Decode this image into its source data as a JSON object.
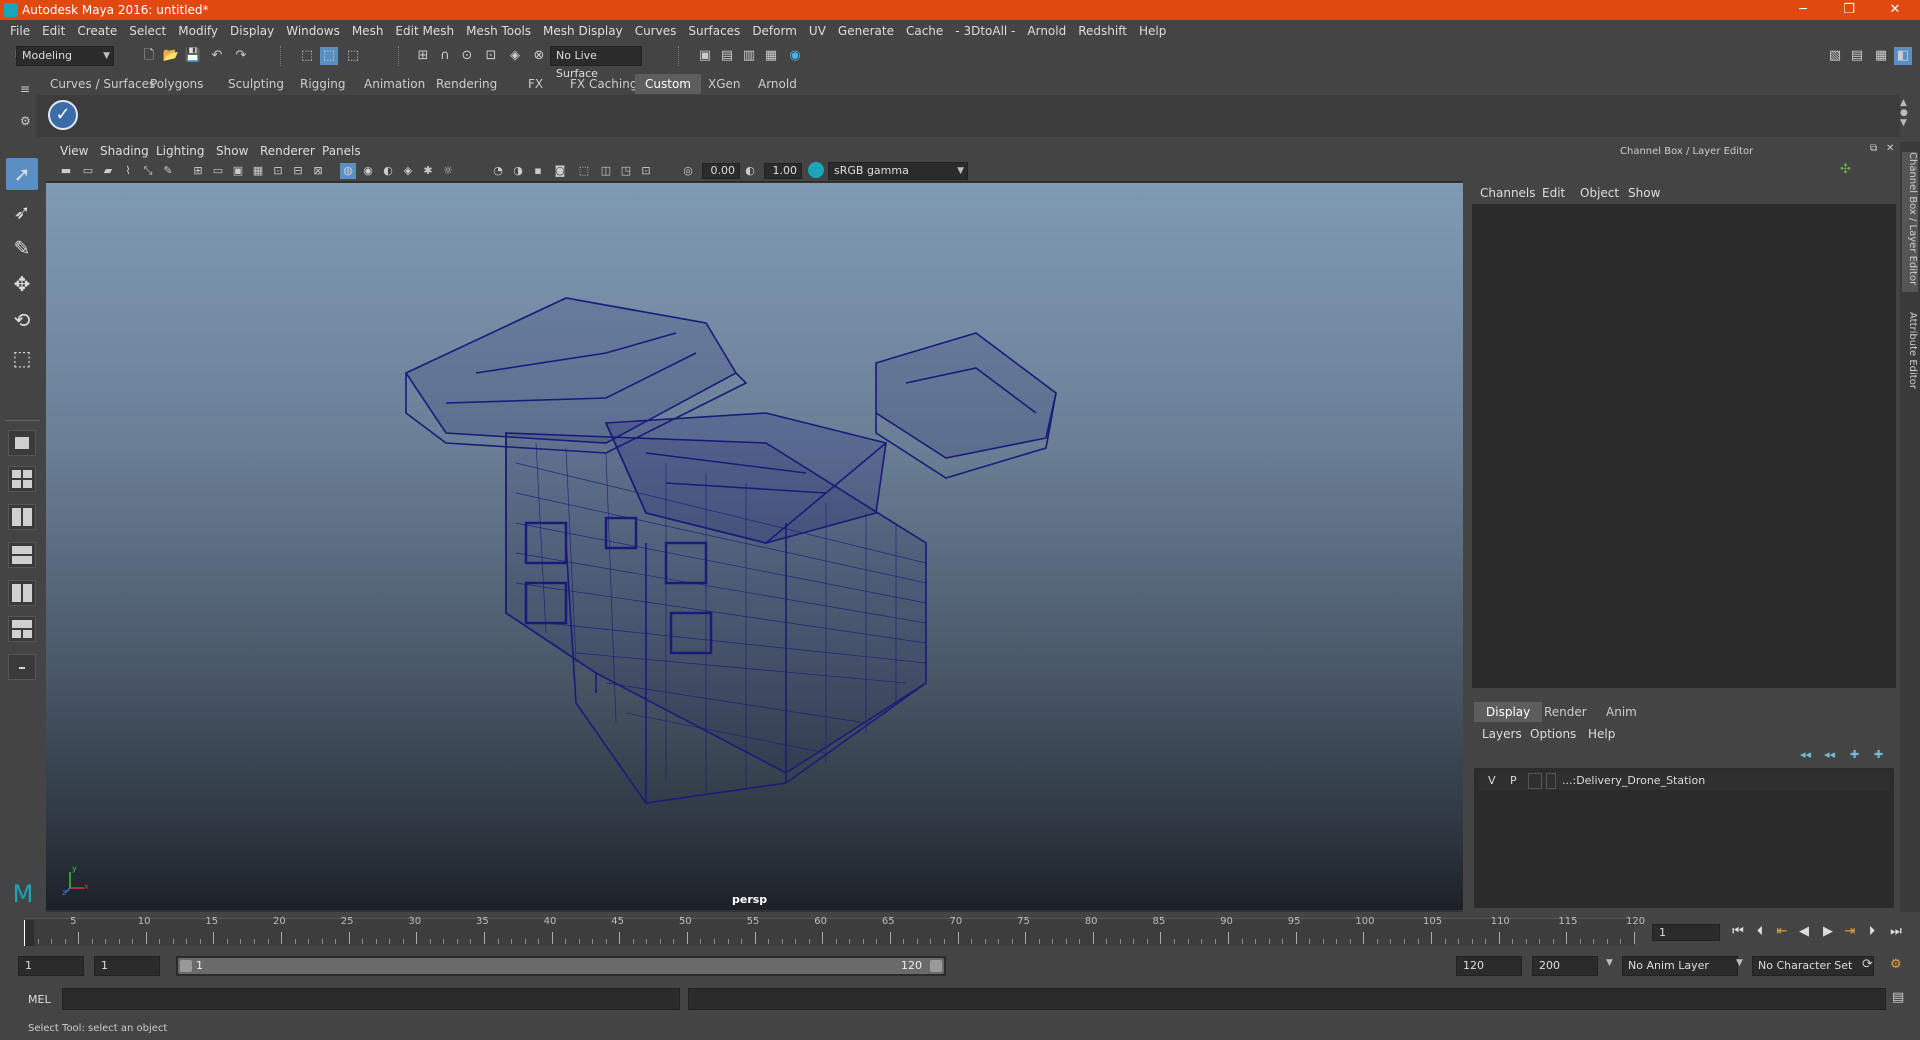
{
  "window": {
    "title": "Autodesk Maya 2016: untitled*",
    "min": "─",
    "max": "❐",
    "close": "✕"
  },
  "menubar": [
    "File",
    "Edit",
    "Create",
    "Select",
    "Modify",
    "Display",
    "Windows",
    "Mesh",
    "Edit Mesh",
    "Mesh Tools",
    "Mesh Display",
    "Curves",
    "Surfaces",
    "Deform",
    "UV",
    "Generate",
    "Cache",
    "- 3DtoAll -",
    "Arnold",
    "Redshift",
    "Help"
  ],
  "statusline": {
    "mode": "Modeling",
    "live_surface": "No Live Surface"
  },
  "shelf": {
    "tabs": [
      "Curves / Surfaces",
      "Polygons",
      "Sculpting",
      "Rigging",
      "Animation",
      "Rendering",
      "FX",
      "FX Caching",
      "Custom",
      "XGen",
      "Arnold"
    ],
    "active_tab": "Custom"
  },
  "viewport": {
    "menu": [
      "View",
      "Shading",
      "Lighting",
      "Show",
      "Renderer",
      "Panels"
    ],
    "exposure": "0.00",
    "gamma": "1.00",
    "color_space": "sRGB gamma",
    "camera": "persp",
    "axis_labels": {
      "x": "x",
      "y": "y",
      "z": "z"
    }
  },
  "channelbox": {
    "title": "Channel Box / Layer Editor",
    "menu": [
      "Channels",
      "Edit",
      "Object",
      "Show"
    ]
  },
  "layereditor": {
    "tabs": [
      "Display",
      "Render",
      "Anim"
    ],
    "active_tab": "Display",
    "menu": [
      "Layers",
      "Options",
      "Help"
    ],
    "layers": [
      {
        "visible": "V",
        "playback": "P",
        "name": "...:Delivery_Drone_Station"
      }
    ]
  },
  "sidetabs": [
    "Channel Box / Layer Editor",
    "Attribute Editor"
  ],
  "timeline": {
    "ticks": [
      "5",
      "10",
      "15",
      "20",
      "25",
      "30",
      "35",
      "40",
      "45",
      "50",
      "55",
      "60",
      "65",
      "70",
      "75",
      "80",
      "85",
      "90",
      "95",
      "100",
      "105",
      "110",
      "115",
      "120"
    ],
    "start_tick": "1",
    "current_frame": "1"
  },
  "range": {
    "start": "1",
    "anim_start": "1",
    "slider_start": "1",
    "slider_end": "120",
    "end": "120",
    "anim_end": "200",
    "anim_layer": "No Anim Layer",
    "char_set": "No Character Set"
  },
  "commandline": {
    "label": "MEL"
  },
  "helpline": "Select Tool: select an object"
}
